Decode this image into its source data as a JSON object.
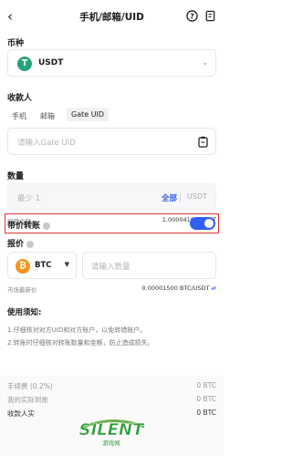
{
  "header": {
    "title": "手机/邮箱/UID",
    "back_icon": "arrow-left-icon",
    "help_icon": "question-circle-icon",
    "history_icon": "document-list-icon"
  },
  "currency": {
    "section_label": "币种",
    "selected": "USDT",
    "icon": "tether-icon"
  },
  "recipient": {
    "section_label": "收款人",
    "tabs": [
      "手机",
      "邮箱",
      "Gate UID"
    ],
    "active_tab": "Gate UID",
    "input_placeholder": "请输入Gate UID",
    "paste_icon": "clipboard-icon"
  },
  "amount": {
    "section_label": "数量",
    "placeholder": "最少 1",
    "all_label": "全部",
    "unit": "USDT",
    "available_label": "可用余额",
    "available_value": "1.00004106 USDT"
  },
  "priced_transfer": {
    "label": "带价转账",
    "enabled": true
  },
  "quote": {
    "section_label": "报价",
    "coin": "BTC",
    "coin_icon": "bitcoin-icon",
    "qty_placeholder": "请输入数量",
    "market_label": "市场最新价",
    "market_value": "0.00001500 BTC/USDT"
  },
  "notice": {
    "title": "使用须知:",
    "lines": [
      "1.仔细核对对方UID和对方账户，以免转错账户。",
      "2.转账时仔细核对转账数量和金额，防止造成损失。"
    ]
  },
  "summary": [
    {
      "label": "手续费 (0.2%)",
      "value": "0 BTC"
    },
    {
      "label": "我的实际到账",
      "value": "0 BTC"
    },
    {
      "label": "收款人实",
      "value": "0 BTC"
    }
  ],
  "watermark": {
    "text": "SILENT",
    "sub": "游戏网"
  },
  "colors": {
    "accent": "#2f5ff4",
    "tether": "#26a17b",
    "bitcoin": "#f7931a",
    "highlight": "#e03333"
  }
}
